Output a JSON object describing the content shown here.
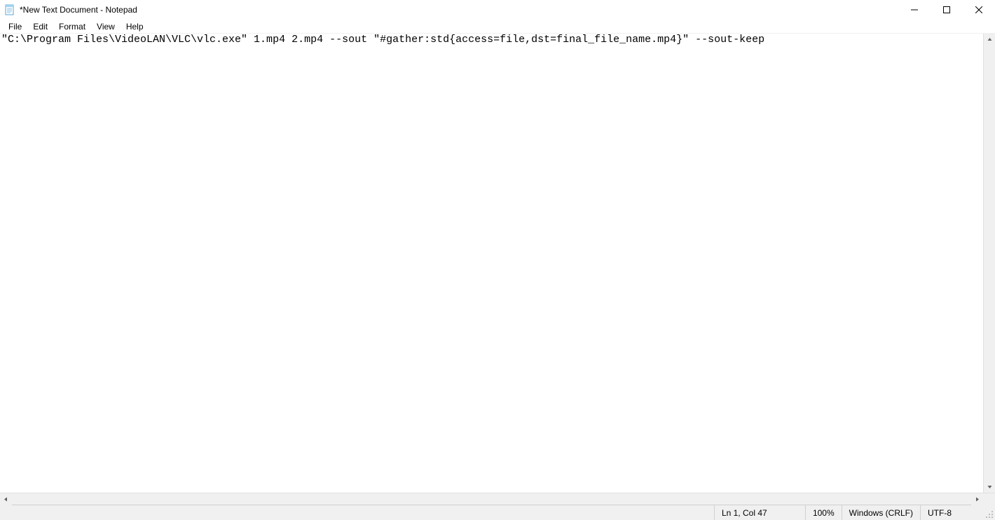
{
  "window": {
    "title": "*New Text Document - Notepad"
  },
  "menubar": {
    "file": "File",
    "edit": "Edit",
    "format": "Format",
    "view": "View",
    "help": "Help"
  },
  "editor": {
    "content": "\"C:\\Program Files\\VideoLAN\\VLC\\vlc.exe\" 1.mp4 2.mp4 --sout \"#gather:std{access=file,dst=final_file_name.mp4}\" --sout-keep"
  },
  "statusbar": {
    "cursor": "Ln 1, Col 47",
    "zoom": "100%",
    "line_ending": "Windows (CRLF)",
    "encoding": "UTF-8"
  }
}
